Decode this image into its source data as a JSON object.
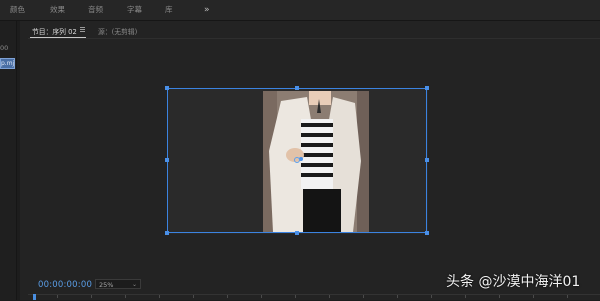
{
  "topbar": {
    "tabs": [
      "颜色",
      "效果",
      "音频",
      "字幕",
      "库"
    ],
    "more_glyph": "»"
  },
  "left_panel": {
    "timecode": "00",
    "clip_label": "p.mj"
  },
  "monitor": {
    "program_tab": "节目：序列 02",
    "source_tab": "源：(无剪辑)",
    "timecode": "00:00:00:00",
    "zoom": "25%",
    "zoom_chevron": "⌄"
  },
  "watermark": "头条 @沙漠中海洋01",
  "colors": {
    "selection": "#3b83e0",
    "timecode": "#5a9de6"
  },
  "icons": {
    "menu": "hamburger-icon",
    "anchor": "anchor-point-icon"
  }
}
